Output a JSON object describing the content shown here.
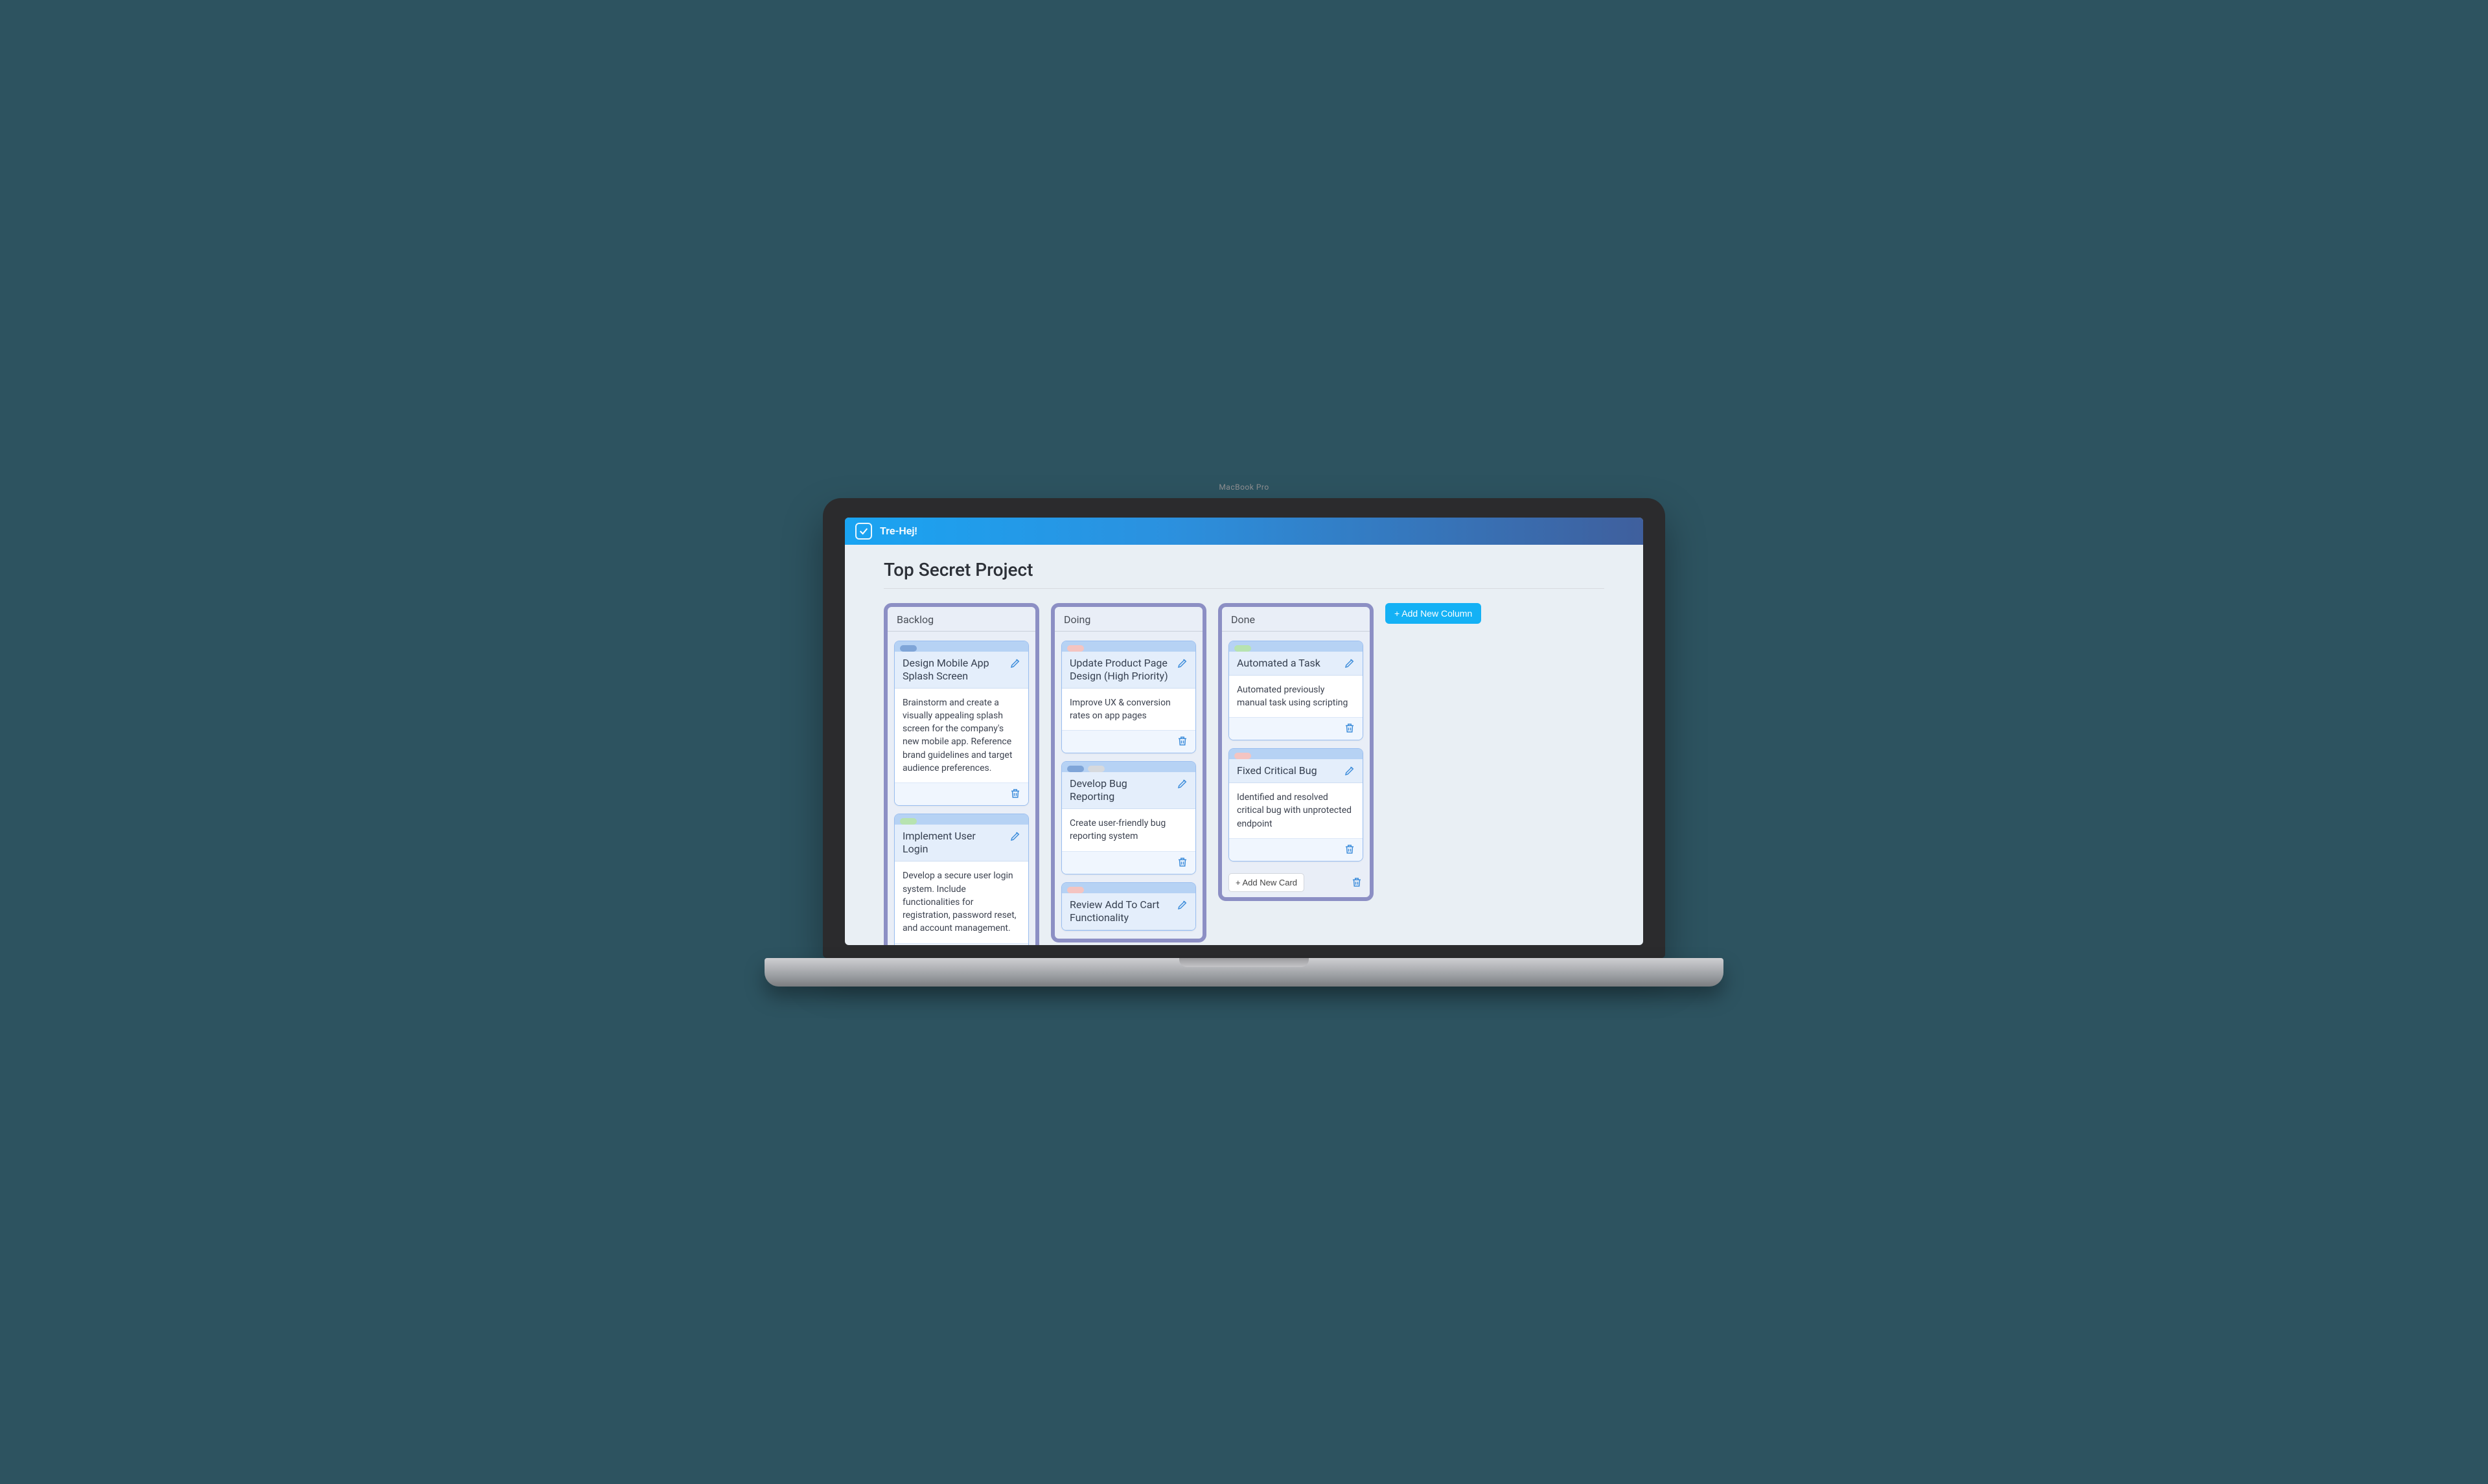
{
  "app": {
    "name": "Tre-Hej!"
  },
  "board": {
    "title": "Top Secret Project",
    "add_column_label": "+ Add New Column"
  },
  "labels": {
    "add_card": "+ Add New Card"
  },
  "colors": {
    "blue": "#7fa5d8",
    "pink": "#f4c4c1",
    "green": "#b7e3b0",
    "gray": "#d6d9dd"
  },
  "columns": [
    {
      "title": "Backlog",
      "show_footer": false,
      "cards": [
        {
          "pills": [
            "blue"
          ],
          "title": "Design Mobile App Splash Screen",
          "body": "Brainstorm and create a visually appealing splash screen for the company's new mobile app. Reference brand guidelines and target audience preferences."
        },
        {
          "pills": [
            "green"
          ],
          "title": "Implement User Login",
          "body": "Develop a secure user login system. Include functionalities for registration, password reset, and account management."
        }
      ]
    },
    {
      "title": "Doing",
      "show_footer": false,
      "cards": [
        {
          "pills": [
            "pink"
          ],
          "title": "Update Product Page Design (High Priority)",
          "body": "Improve UX & conversion rates on app pages"
        },
        {
          "pills": [
            "blue",
            "gray"
          ],
          "title": "Develop Bug Reporting",
          "body": "Create user-friendly bug reporting system"
        },
        {
          "pills": [
            "pink"
          ],
          "title": "Review Add To Cart Functionality",
          "body": ""
        }
      ]
    },
    {
      "title": "Done",
      "show_footer": true,
      "cards": [
        {
          "pills": [
            "green"
          ],
          "title": "Automated a Task",
          "body": "Automated previously manual task using scripting"
        },
        {
          "pills": [
            "pink"
          ],
          "title": "Fixed Critical Bug",
          "body": "Identified and resolved critical bug with unprotected endpoint"
        }
      ]
    }
  ]
}
